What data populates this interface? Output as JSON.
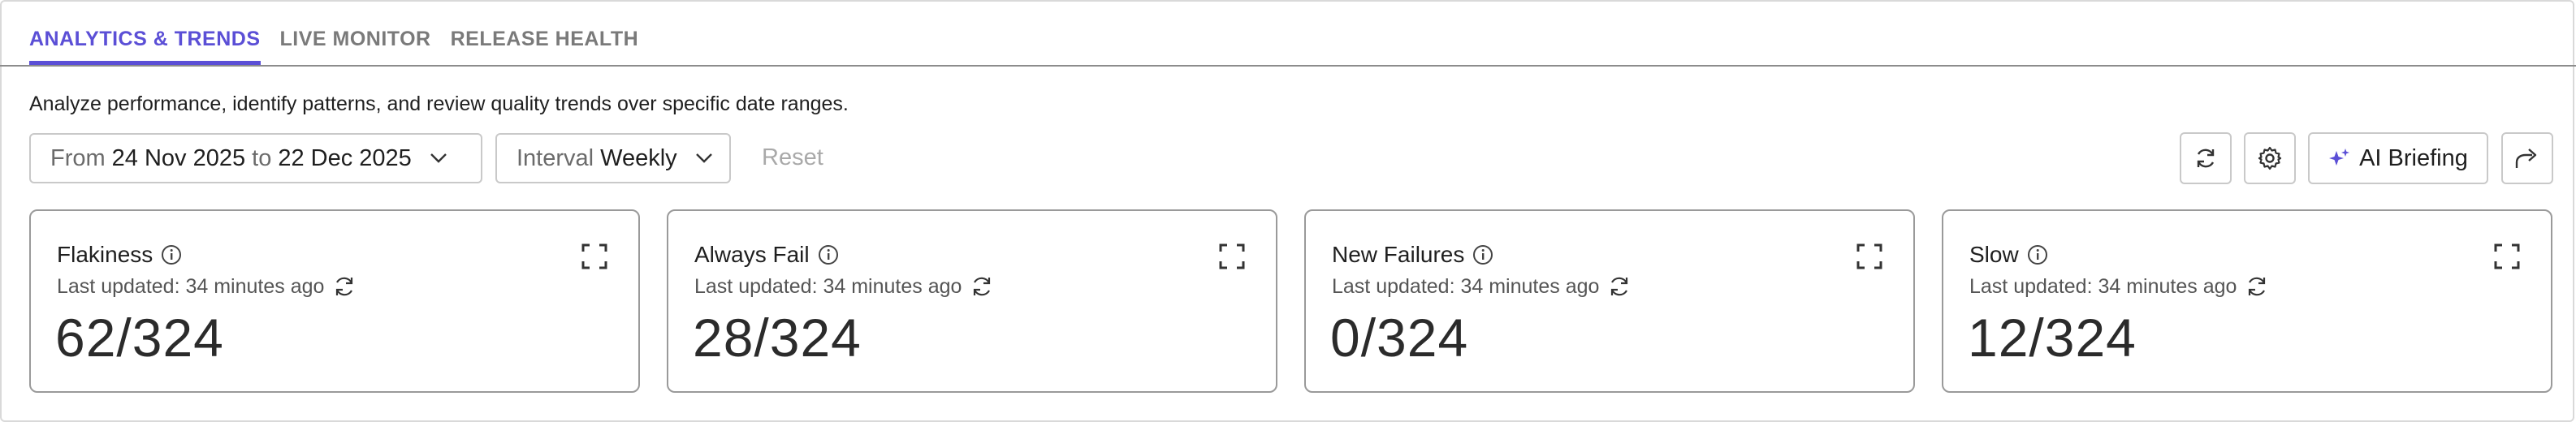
{
  "tabs": [
    {
      "label": "ANALYTICS & TRENDS",
      "active": true
    },
    {
      "label": "LIVE MONITOR",
      "active": false
    },
    {
      "label": "RELEASE HEALTH",
      "active": false
    }
  ],
  "description": "Analyze performance, identify patterns, and review quality trends over specific date ranges.",
  "date_filter": {
    "from_label": "From",
    "from_value": "24 Nov 2025",
    "to_label": "to",
    "to_value": "22 Dec 2025"
  },
  "interval_filter": {
    "label": "Interval",
    "value": "Weekly"
  },
  "reset_label": "Reset",
  "toolbar": {
    "refresh_icon": "refresh-icon",
    "settings_icon": "gear-icon",
    "ai_label": "AI Briefing",
    "ai_icon": "sparkle-icon",
    "share_icon": "share-icon",
    "accent_color": "#5b4fd6"
  },
  "cards": [
    {
      "title": "Flakiness",
      "updated": "Last updated: 34 minutes ago",
      "value": "62/324"
    },
    {
      "title": "Always Fail",
      "updated": "Last updated: 34 minutes ago",
      "value": "28/324"
    },
    {
      "title": "New Failures",
      "updated": "Last updated: 34 minutes ago",
      "value": "0/324"
    },
    {
      "title": "Slow",
      "updated": "Last updated: 34 minutes ago",
      "value": "12/324"
    }
  ]
}
